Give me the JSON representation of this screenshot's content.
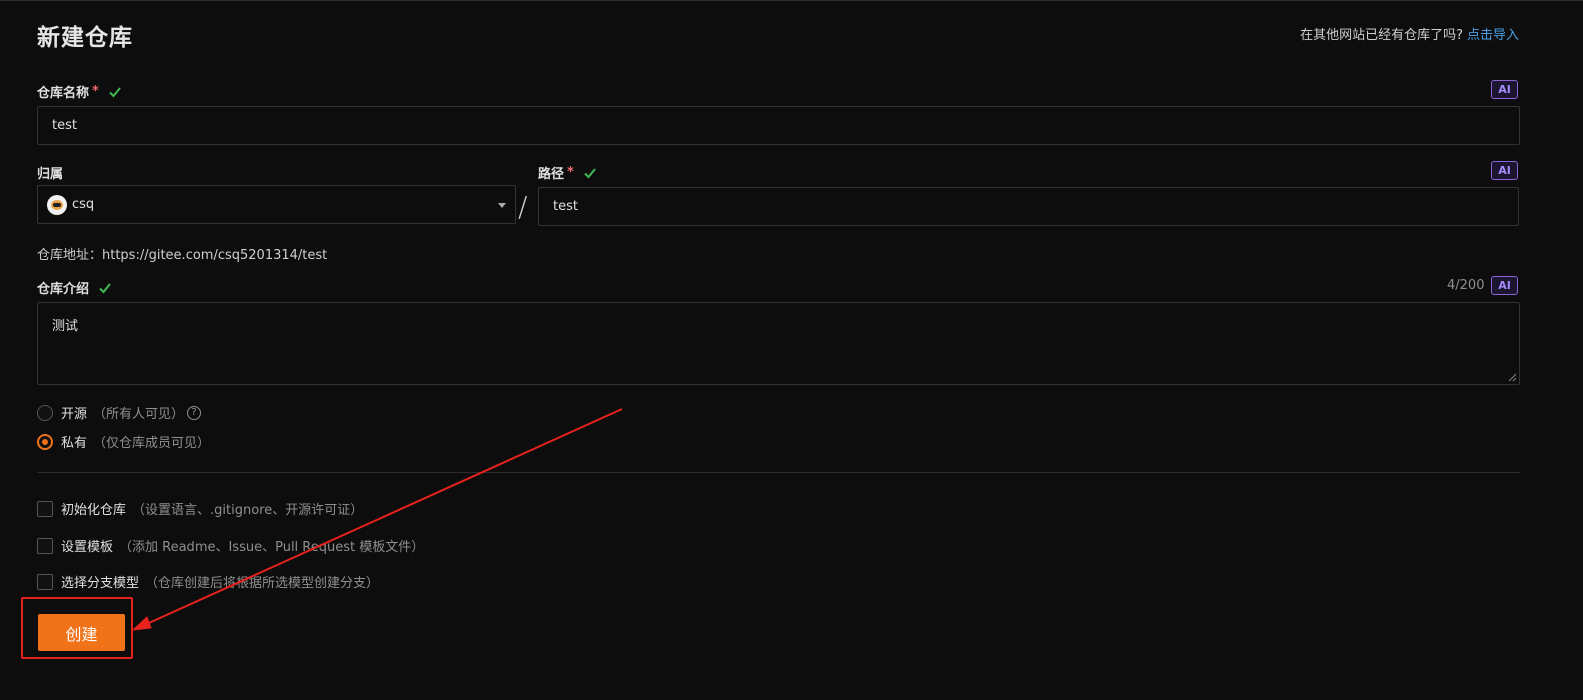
{
  "page": {
    "title": "新建仓库",
    "import_hint": "在其他网站已经有仓库了吗?",
    "import_link": "点击导入"
  },
  "repo_name": {
    "label": "仓库名称",
    "required_mark": "*",
    "value": "test",
    "ai_badge": "AI"
  },
  "owner": {
    "label": "归属",
    "value": "csq"
  },
  "path": {
    "label": "路径",
    "required_mark": "*",
    "value": "test",
    "ai_badge": "AI",
    "separator": "/"
  },
  "repo_url": "仓库地址：https://gitee.com/csq5201314/test",
  "description": {
    "label": "仓库介绍",
    "value": "测试",
    "counter": "4/200",
    "ai_badge": "AI"
  },
  "visibility": {
    "options": [
      {
        "label": "开源",
        "desc": "（所有人可见）",
        "checked": false
      },
      {
        "label": "私有",
        "desc": "（仅仓库成员可见）",
        "checked": true
      }
    ],
    "help_glyph": "?"
  },
  "options": [
    {
      "label": "初始化仓库",
      "desc": "（设置语言、.gitignore、开源许可证）"
    },
    {
      "label": "设置模板",
      "desc": "（添加 Readme、Issue、Pull Request 模板文件）"
    },
    {
      "label": "选择分支模型",
      "desc": "（仓库创建后将根据所选模型创建分支）"
    }
  ],
  "submit": {
    "label": "创建"
  },
  "colors": {
    "accent": "#f0731a",
    "link": "#4c9fe6",
    "check": "#3fb950",
    "annotation": "#e8221c"
  }
}
